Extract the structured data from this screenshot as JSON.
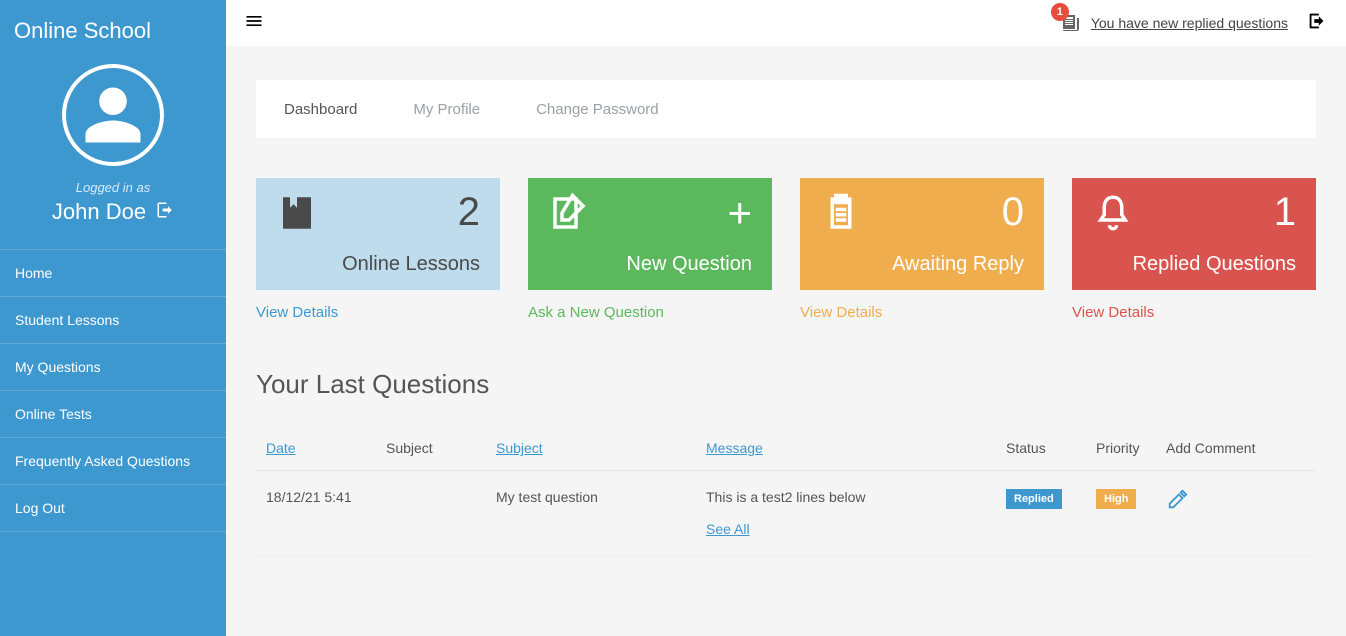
{
  "brand": "Online School",
  "user": {
    "logged_label": "Logged in as",
    "name": "John Doe"
  },
  "sidebar": {
    "items": [
      {
        "label": "Home"
      },
      {
        "label": "Student Lessons"
      },
      {
        "label": "My Questions"
      },
      {
        "label": "Online Tests"
      },
      {
        "label": "Frequently Asked Questions"
      },
      {
        "label": "Log Out"
      }
    ]
  },
  "topbar": {
    "notif_count": "1",
    "notif_text": "You have new replied questions"
  },
  "tabs": [
    {
      "label": "Dashboard"
    },
    {
      "label": "My Profile"
    },
    {
      "label": "Change Password"
    }
  ],
  "cards": [
    {
      "num": "2",
      "label": "Online Lessons",
      "link": "View Details"
    },
    {
      "plus": "+",
      "label": "New Question",
      "link": "Ask a New Question"
    },
    {
      "num": "0",
      "label": "Awaiting Reply",
      "link": "View Details"
    },
    {
      "num": "1",
      "label": "Replied Questions",
      "link": "View Details"
    }
  ],
  "section_title": "Your Last Questions",
  "table": {
    "headers": {
      "date": "Date",
      "subject1": "Subject",
      "subject2": "Subject",
      "message": "Message",
      "status": "Status",
      "priority": "Priority",
      "comment": "Add Comment"
    },
    "rows": [
      {
        "date": "18/12/21 5:41",
        "subject": "My test question",
        "message": "This is a test2 lines below",
        "see_all": "See All",
        "status": "Replied",
        "priority": "High"
      }
    ]
  }
}
